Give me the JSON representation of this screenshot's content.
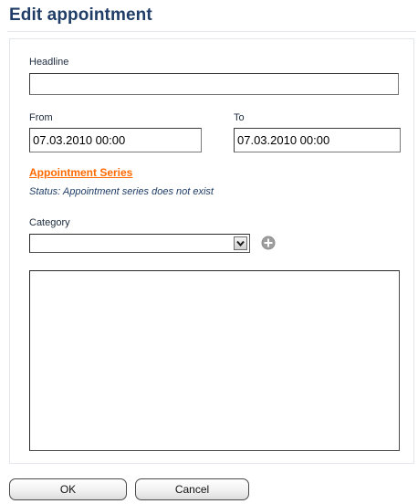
{
  "dialog": {
    "title": "Edit appointment"
  },
  "form": {
    "headline": {
      "label": "Headline",
      "value": ""
    },
    "from": {
      "label": "From",
      "value": "07.03.2010 00:00"
    },
    "to": {
      "label": "To",
      "value": "07.03.2010 00:00"
    },
    "series": {
      "link_label": "Appointment Series",
      "status_text": "Status: Appointment series does not exist"
    },
    "category": {
      "label": "Category",
      "selected": ""
    },
    "notes": {
      "value": ""
    }
  },
  "buttons": {
    "ok_label": "OK",
    "cancel_label": "Cancel"
  },
  "icons": {
    "dropdown": "chevron-down-icon",
    "add": "plus-circle-icon"
  },
  "colors": {
    "title": "#1f3d66",
    "link": "#ff6a00",
    "status": "#1f3d66"
  }
}
